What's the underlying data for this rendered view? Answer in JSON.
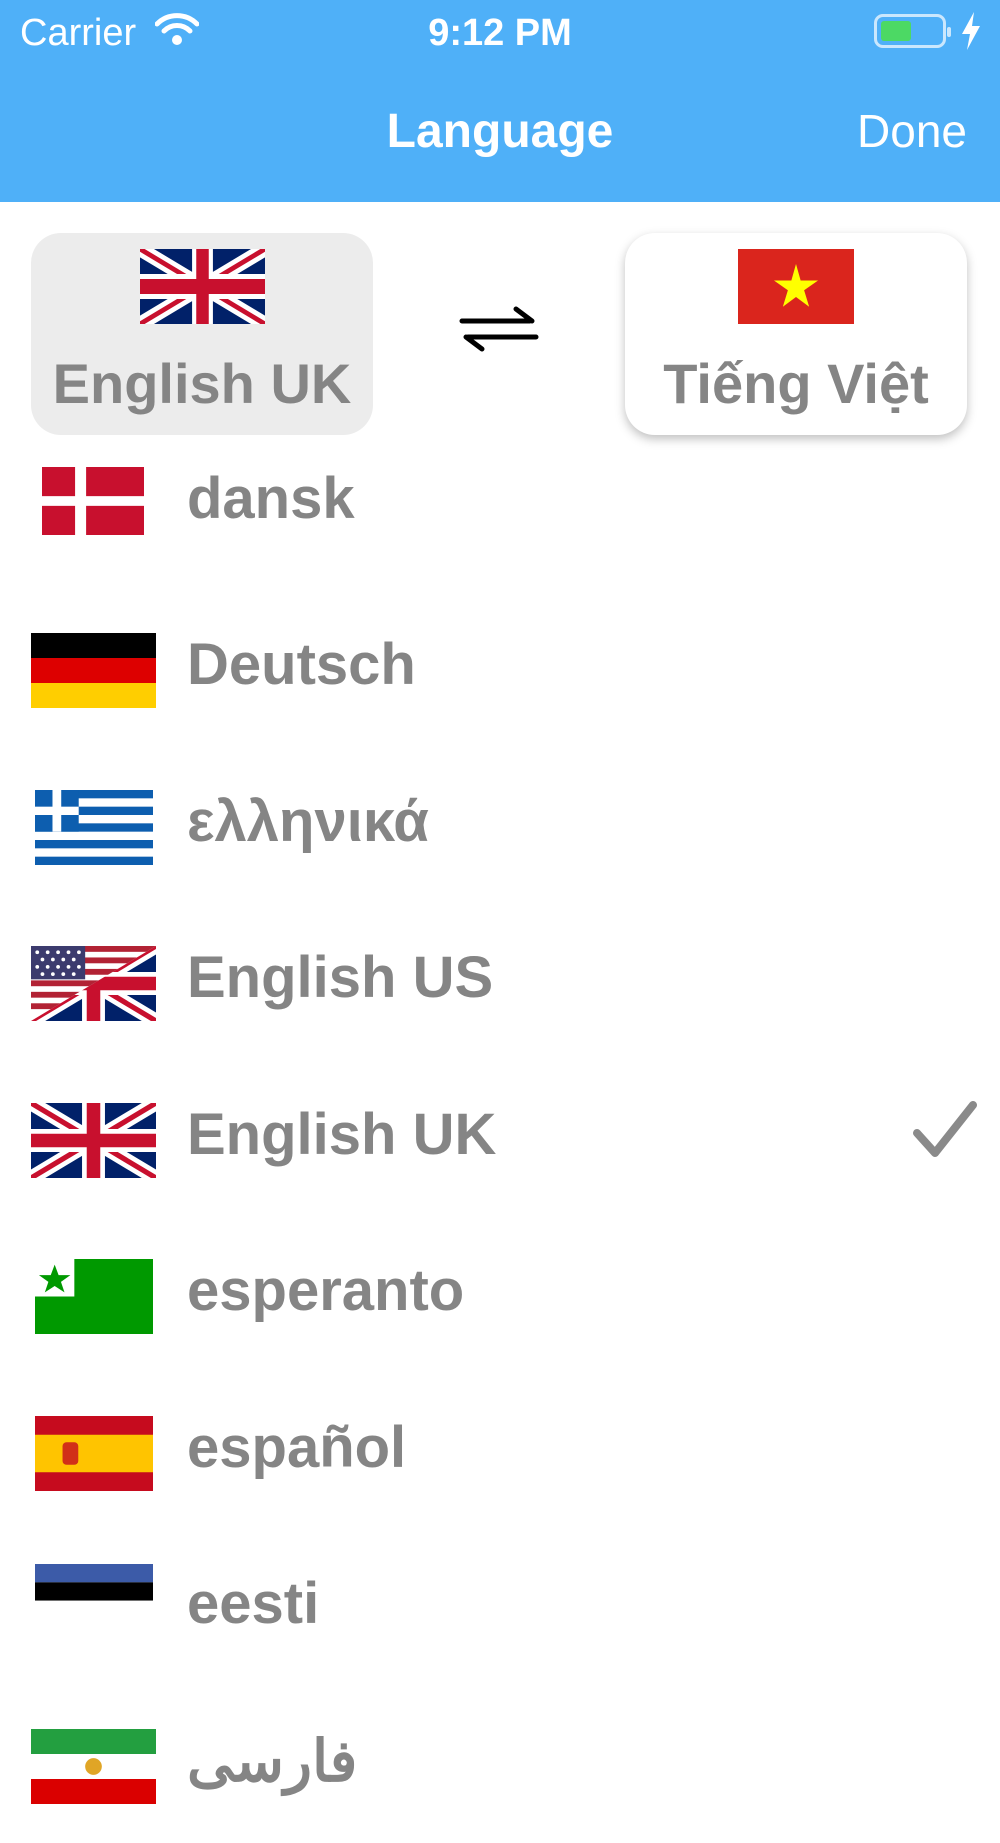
{
  "status_bar": {
    "carrier": "Carrier",
    "time": "9:12 PM"
  },
  "nav": {
    "title": "Language",
    "done": "Done"
  },
  "selector": {
    "from": {
      "label": "English UK",
      "flag": "flag-uk"
    },
    "to": {
      "label": "Tiếng Việt",
      "flag": "flag-vietnam"
    },
    "swap_icon": "swap-arrows-icon"
  },
  "languages": [
    {
      "name": "dansk",
      "flag": "flag-denmark",
      "selected": false
    },
    {
      "name": "Deutsch",
      "flag": "flag-germany",
      "selected": false
    },
    {
      "name": "ελληνικά",
      "flag": "flag-greece",
      "selected": false
    },
    {
      "name": "English US",
      "flag": "flag-us-uk",
      "selected": false
    },
    {
      "name": "English UK",
      "flag": "flag-uk",
      "selected": true
    },
    {
      "name": "esperanto",
      "flag": "flag-esperanto",
      "selected": false
    },
    {
      "name": "español",
      "flag": "flag-spain",
      "selected": false
    },
    {
      "name": "eesti",
      "flag": "flag-estonia",
      "selected": false
    },
    {
      "name": "فارسی",
      "flag": "flag-iran",
      "selected": false
    }
  ],
  "colors": {
    "accent": "#4fb0f8",
    "text_gray": "#858585"
  }
}
